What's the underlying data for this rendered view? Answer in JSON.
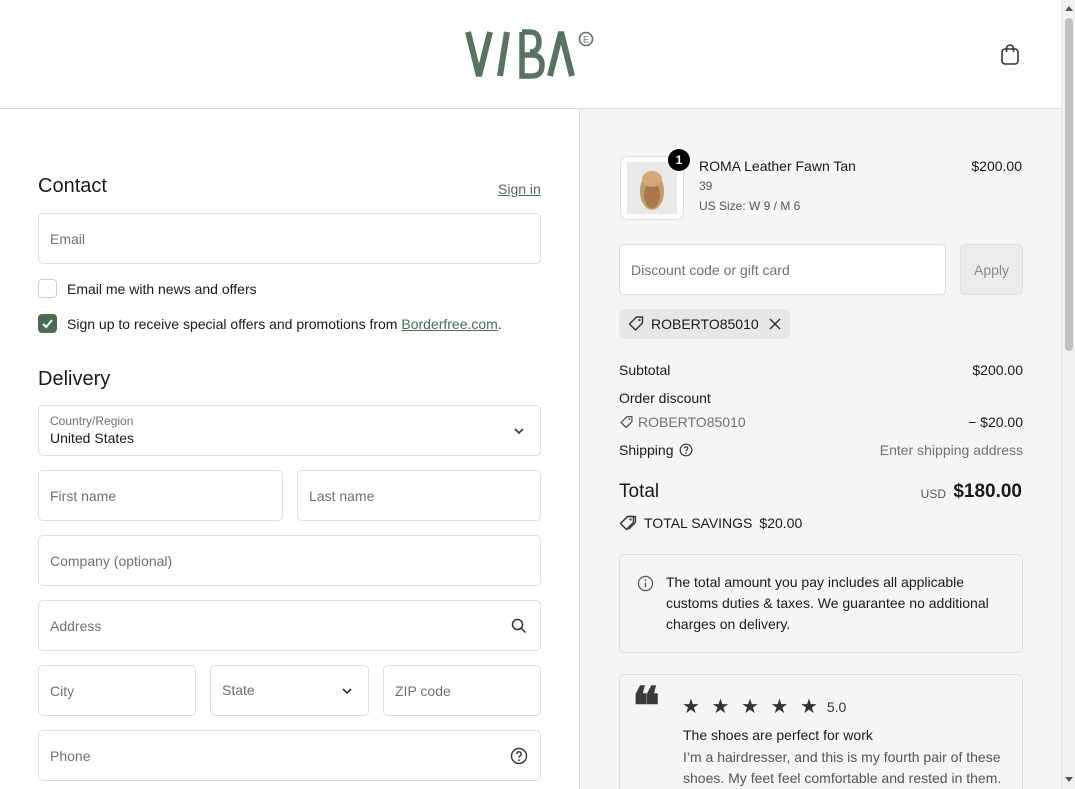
{
  "header": {
    "logo_text": "VIBA",
    "cart_icon": "shopping-bag-icon"
  },
  "contact": {
    "title": "Contact",
    "signin_label": "Sign in",
    "email_placeholder": "Email",
    "newsletter_label": "Email me with news and offers",
    "newsletter_checked": false,
    "offers_label_prefix": "Sign up to receive special offers and promotions from ",
    "offers_link": "Borderfree.com",
    "offers_label_suffix": ".",
    "offers_checked": true
  },
  "delivery": {
    "title": "Delivery",
    "country_label": "Country/Region",
    "country_value": "United States",
    "first_name_placeholder": "First name",
    "last_name_placeholder": "Last name",
    "company_placeholder": "Company (optional)",
    "address_placeholder": "Address",
    "city_placeholder": "City",
    "state_placeholder": "State",
    "zip_placeholder": "ZIP code",
    "phone_placeholder": "Phone"
  },
  "order": {
    "item": {
      "name": "ROMA Leather Fawn Tan",
      "variant": "39",
      "size": "US Size: W 9 / M 6",
      "price": "$200.00",
      "quantity": "1"
    },
    "discount_placeholder": "Discount code or gift card",
    "apply_label": "Apply",
    "applied_code": "ROBERTO85010",
    "subtotal_label": "Subtotal",
    "subtotal_value": "$200.00",
    "order_discount_label": "Order discount",
    "discount_code": "ROBERTO85010",
    "discount_value": "− $20.00",
    "shipping_label": "Shipping",
    "shipping_value": "Enter shipping address",
    "total_label": "Total",
    "total_currency": "USD",
    "total_value": "$180.00",
    "savings_label": "TOTAL SAVINGS",
    "savings_value": "$20.00",
    "info_text": "The total amount you pay includes all applicable customs duties & taxes. We guarantee no additional charges on delivery."
  },
  "review": {
    "stars": "★ ★ ★ ★ ★",
    "rating": "5.0",
    "title": "The shoes are perfect for work",
    "body": "I’m a hairdresser, and this is my fourth pair of these shoes. My feet feel comfortable and rested in them."
  },
  "colors": {
    "brand_green": "#4b6b53",
    "summary_bg": "#f5f5f5"
  }
}
